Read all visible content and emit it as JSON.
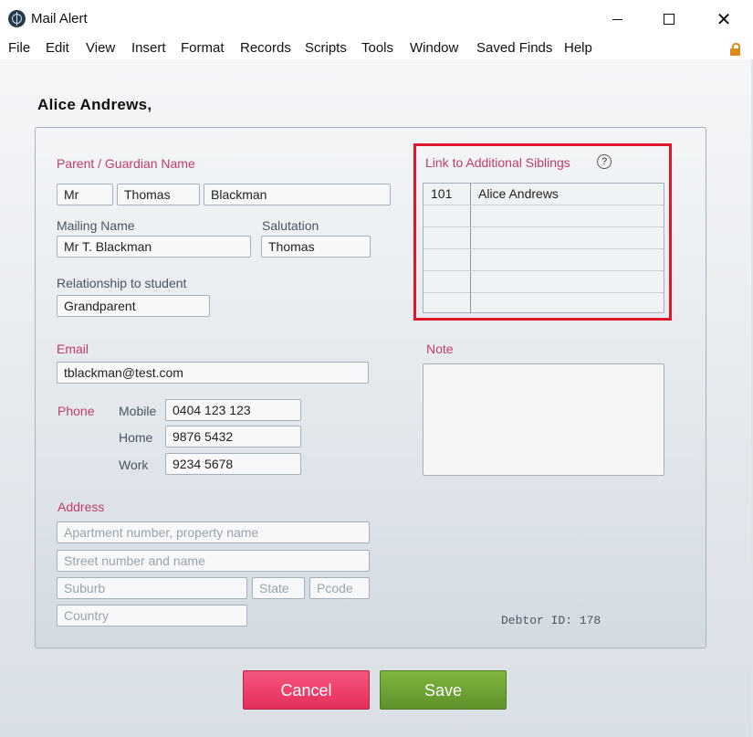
{
  "window": {
    "title": "Mail Alert"
  },
  "menu": [
    "File",
    "Edit",
    "View",
    "Insert",
    "Format",
    "Records",
    "Scripts",
    "Tools",
    "Window",
    "Saved Finds",
    "Help"
  ],
  "record_heading": "Alice Andrews,",
  "guardian": {
    "label": "Parent / Guardian Name",
    "title": "Mr",
    "first_name": "Thomas",
    "last_name": "Blackman",
    "mailing_name_label": "Mailing Name",
    "mailing_name": "Mr T. Blackman",
    "salutation_label": "Salutation",
    "salutation": "Thomas",
    "relationship_label": "Relationship to student",
    "relationship": "Grandparent"
  },
  "email": {
    "label": "Email",
    "value": "tblackman@test.com"
  },
  "phone": {
    "label": "Phone",
    "mobile_label": "Mobile",
    "mobile": "0404 123 123",
    "home_label": "Home",
    "home": "9876 5432",
    "work_label": "Work",
    "work": "9234 5678"
  },
  "address": {
    "label": "Address",
    "line1_placeholder": "Apartment number, property name",
    "line2_placeholder": "Street number and name",
    "suburb_placeholder": "Suburb",
    "state_placeholder": "State",
    "pcode_placeholder": "Pcode",
    "country_placeholder": "Country"
  },
  "siblings": {
    "label": "Link to Additional Siblings",
    "help_glyph": "?",
    "rows": [
      {
        "id": "101",
        "name": "Alice Andrews"
      },
      {
        "id": "",
        "name": ""
      },
      {
        "id": "",
        "name": ""
      },
      {
        "id": "",
        "name": ""
      },
      {
        "id": "",
        "name": ""
      },
      {
        "id": "",
        "name": ""
      }
    ]
  },
  "note": {
    "label": "Note",
    "value": ""
  },
  "debtor": "Debtor ID:  178",
  "buttons": {
    "cancel": "Cancel",
    "save": "Save"
  },
  "colors": {
    "highlight": "#e0162b",
    "label_accent": "#c23b6b",
    "cancel": "#e8345f",
    "save": "#6fa235"
  },
  "icons": {
    "app": "app-globe-icon",
    "lock": "lock-icon",
    "help": "help-circle-icon"
  }
}
